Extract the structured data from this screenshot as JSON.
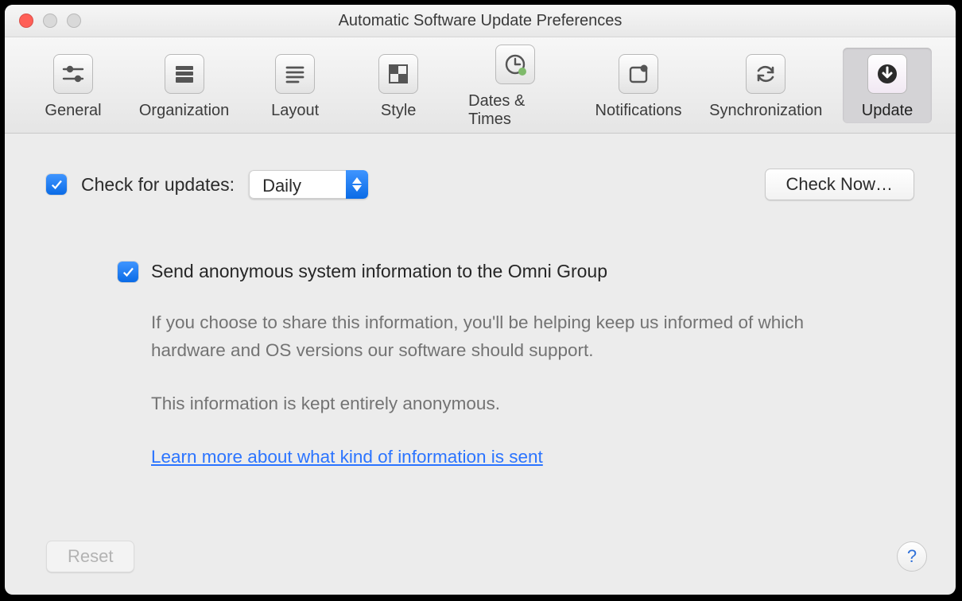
{
  "window": {
    "title": "Automatic Software Update Preferences"
  },
  "toolbar": {
    "items": [
      {
        "label": "General"
      },
      {
        "label": "Organization"
      },
      {
        "label": "Layout"
      },
      {
        "label": "Style"
      },
      {
        "label": "Dates & Times"
      },
      {
        "label": "Notifications"
      },
      {
        "label": "Synchronization"
      },
      {
        "label": "Update"
      }
    ],
    "selected_index": 7
  },
  "check_for_updates": {
    "checked": true,
    "label": "Check for updates:",
    "frequency_selected": "Daily"
  },
  "buttons": {
    "check_now": "Check Now…",
    "reset": "Reset",
    "help": "?"
  },
  "send_info": {
    "checked": true,
    "label": "Send anonymous system information to the Omni Group",
    "description1": "If you choose to share this information, you'll be helping keep us informed of which hardware and OS versions our software should support.",
    "description2": "This information is kept entirely anonymous.",
    "link_text": "Learn more about what kind of information is sent"
  }
}
